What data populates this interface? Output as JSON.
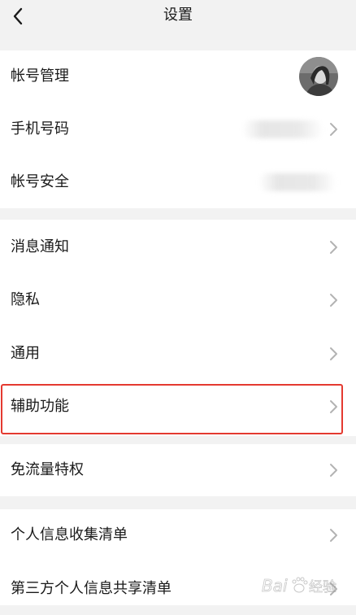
{
  "header": {
    "title": "设置",
    "back_icon": "chevron-left-icon"
  },
  "groups": [
    {
      "items": [
        {
          "label": "帐号管理",
          "trailing": "avatar"
        },
        {
          "label": "手机号码",
          "trailing": "blurred-value+chevron"
        },
        {
          "label": "帐号安全",
          "trailing": "blurred-value"
        }
      ]
    },
    {
      "items": [
        {
          "label": "消息通知",
          "trailing": "chevron"
        },
        {
          "label": "隐私",
          "trailing": "chevron"
        },
        {
          "label": "通用",
          "trailing": "chevron"
        },
        {
          "label": "辅助功能",
          "trailing": "chevron",
          "highlighted": true
        }
      ]
    },
    {
      "items": [
        {
          "label": "免流量特权",
          "trailing": "chevron"
        }
      ]
    },
    {
      "items": [
        {
          "label": "个人信息收集清单",
          "trailing": "chevron"
        },
        {
          "label": "第三方个人信息共享清单",
          "trailing": "chevron"
        }
      ]
    }
  ],
  "colors": {
    "background": "#f2f2f2",
    "row_background": "#ffffff",
    "text": "#1a1a1a",
    "chevron": "#b3b3b3",
    "highlight_border": "#e43a30"
  },
  "watermark": {
    "text": "Bai度经验",
    "icon": "baidu-paw-icon"
  }
}
